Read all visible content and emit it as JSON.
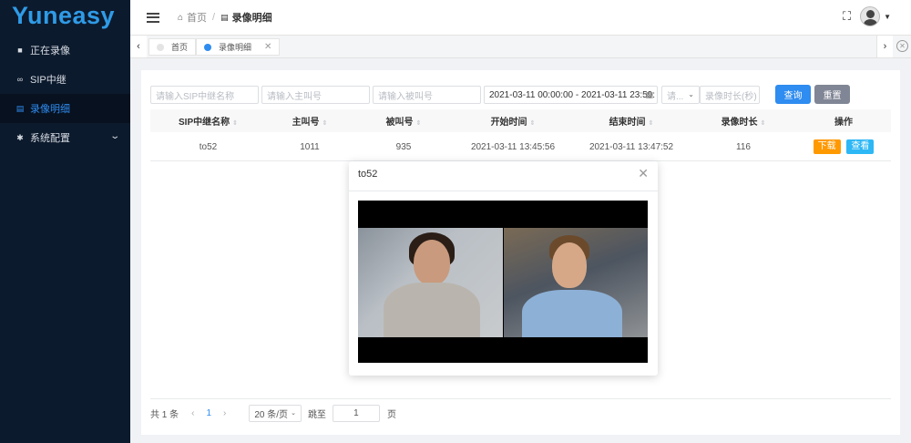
{
  "sidebar": {
    "logo": "Yuneasy",
    "items": [
      {
        "label": "正在录像",
        "icon": "video-camera-icon"
      },
      {
        "label": "SIP中继",
        "icon": "link-icon"
      },
      {
        "label": "录像明细",
        "icon": "document-icon",
        "active": true
      },
      {
        "label": "系统配置",
        "icon": "gear-icon",
        "has_submenu": true
      }
    ]
  },
  "header": {
    "breadcrumb": {
      "home": "首页",
      "current": "录像明细"
    }
  },
  "tabs": [
    {
      "label": "首页",
      "active": false
    },
    {
      "label": "录像明细",
      "active": true
    }
  ],
  "filters": {
    "trunk_name_placeholder": "请输入SIP中继名称",
    "caller_placeholder": "请输入主叫号",
    "callee_placeholder": "请输入被叫号",
    "date_range": "2021-03-11 00:00:00 - 2021-03-11 23:59:",
    "select_placeholder": "请...",
    "duration_placeholder": "录像时长(秒)",
    "query_label": "查询",
    "reset_label": "重置"
  },
  "table": {
    "columns": [
      "SIP中继名称",
      "主叫号",
      "被叫号",
      "开始时间",
      "结束时间",
      "录像时长",
      "操作"
    ],
    "rows": [
      {
        "trunk": "to52",
        "caller": "1011",
        "callee": "935",
        "start": "2021-03-11 13:45:56",
        "end": "2021-03-11 13:47:52",
        "duration": "116",
        "download_label": "下载",
        "view_label": "查看"
      }
    ]
  },
  "pagination": {
    "total": "共 1 条",
    "current_page": "1",
    "page_size": "20 条/页",
    "jump_label": "跳至",
    "jump_value": "1",
    "page_suffix": "页"
  },
  "modal": {
    "title": "to52"
  },
  "colors": {
    "sidebar_bg": "#0c1a2d",
    "accent": "#2f8cf0",
    "download": "#ff9900",
    "view": "#2db7f5",
    "reset": "#808695"
  }
}
